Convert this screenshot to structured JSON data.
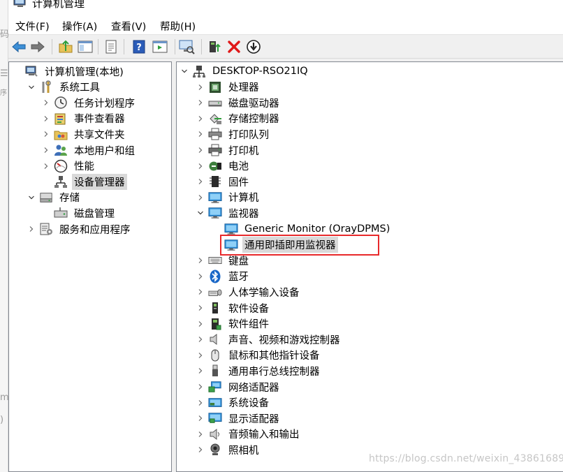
{
  "window": {
    "title": "计算机管理"
  },
  "menu": [
    "文件(F)",
    "操作(A)",
    "查看(V)",
    "帮助(H)"
  ],
  "toolbar_icons": [
    "back-arrow-icon",
    "forward-arrow-icon",
    "up-folder-icon",
    "show-hide-tree-icon",
    "properties-icon",
    "help-icon",
    "action-pane-icon",
    "scan-hardware-icon",
    "update-driver-icon",
    "uninstall-x-icon",
    "disable-device-icon"
  ],
  "left_tree": [
    {
      "label": "计算机管理(本地)",
      "level": 0,
      "chevron": "none",
      "icon": "computer-management-icon"
    },
    {
      "label": "系统工具",
      "level": 1,
      "chevron": "down",
      "icon": "tools-icon"
    },
    {
      "label": "任务计划程序",
      "level": 2,
      "chevron": "right",
      "icon": "clock-icon"
    },
    {
      "label": "事件查看器",
      "level": 2,
      "chevron": "right",
      "icon": "event-viewer-icon"
    },
    {
      "label": "共享文件夹",
      "level": 2,
      "chevron": "right",
      "icon": "shared-folder-icon"
    },
    {
      "label": "本地用户和组",
      "level": 2,
      "chevron": "right",
      "icon": "users-icon"
    },
    {
      "label": "性能",
      "level": 2,
      "chevron": "right",
      "icon": "performance-icon"
    },
    {
      "label": "设备管理器",
      "level": 2,
      "chevron": "none",
      "icon": "device-manager-icon",
      "selected": true
    },
    {
      "label": "存储",
      "level": 1,
      "chevron": "down",
      "icon": "storage-icon"
    },
    {
      "label": "磁盘管理",
      "level": 2,
      "chevron": "none",
      "icon": "disk-management-icon"
    },
    {
      "label": "服务和应用程序",
      "level": 1,
      "chevron": "right",
      "icon": "services-icon"
    }
  ],
  "device_tree": [
    {
      "label": "DESKTOP-RSO21IQ",
      "level": 0,
      "chevron": "down",
      "icon": "computer-node-icon"
    },
    {
      "label": "处理器",
      "level": 1,
      "chevron": "right",
      "icon": "processor-icon"
    },
    {
      "label": "磁盘驱动器",
      "level": 1,
      "chevron": "right",
      "icon": "disk-drive-icon"
    },
    {
      "label": "存储控制器",
      "level": 1,
      "chevron": "right",
      "icon": "storage-controller-icon"
    },
    {
      "label": "打印队列",
      "level": 1,
      "chevron": "right",
      "icon": "print-queue-icon"
    },
    {
      "label": "打印机",
      "level": 1,
      "chevron": "right",
      "icon": "printer-icon"
    },
    {
      "label": "电池",
      "level": 1,
      "chevron": "right",
      "icon": "battery-icon"
    },
    {
      "label": "固件",
      "level": 1,
      "chevron": "right",
      "icon": "firmware-icon"
    },
    {
      "label": "计算机",
      "level": 1,
      "chevron": "right",
      "icon": "monitor-icon"
    },
    {
      "label": "监视器",
      "level": 1,
      "chevron": "down",
      "icon": "monitor-icon"
    },
    {
      "label": "Generic Monitor (OrayDPMS)",
      "level": 2,
      "chevron": "none",
      "icon": "monitor-icon"
    },
    {
      "label": "通用即插即用监视器",
      "level": 2,
      "chevron": "none",
      "icon": "monitor-icon",
      "selected": true
    },
    {
      "label": "键盘",
      "level": 1,
      "chevron": "right",
      "icon": "keyboard-icon"
    },
    {
      "label": "蓝牙",
      "level": 1,
      "chevron": "right",
      "icon": "bluetooth-icon"
    },
    {
      "label": "人体学输入设备",
      "level": 1,
      "chevron": "right",
      "icon": "hid-icon"
    },
    {
      "label": "软件设备",
      "level": 1,
      "chevron": "right",
      "icon": "software-device-icon"
    },
    {
      "label": "软件组件",
      "level": 1,
      "chevron": "right",
      "icon": "software-component-icon"
    },
    {
      "label": "声音、视频和游戏控制器",
      "level": 1,
      "chevron": "right",
      "icon": "speaker-icon"
    },
    {
      "label": "鼠标和其他指针设备",
      "level": 1,
      "chevron": "right",
      "icon": "mouse-icon"
    },
    {
      "label": "通用串行总线控制器",
      "level": 1,
      "chevron": "right",
      "icon": "usb-icon"
    },
    {
      "label": "网络适配器",
      "level": 1,
      "chevron": "right",
      "icon": "network-adapter-icon"
    },
    {
      "label": "系统设备",
      "level": 1,
      "chevron": "right",
      "icon": "system-device-icon"
    },
    {
      "label": "显示适配器",
      "level": 1,
      "chevron": "right",
      "icon": "display-adapter-icon"
    },
    {
      "label": "音频输入和输出",
      "level": 1,
      "chevron": "right",
      "icon": "audio-io-icon"
    },
    {
      "label": "照相机",
      "level": 1,
      "chevron": "right",
      "icon": "camera-icon"
    }
  ],
  "watermark": "https://blog.csdn.net/weixin_43861689",
  "colors": {
    "highlight_border": "#e8292b",
    "selection_bg": "#d9d9d9",
    "monitor_blue": "#2f8fd8"
  }
}
